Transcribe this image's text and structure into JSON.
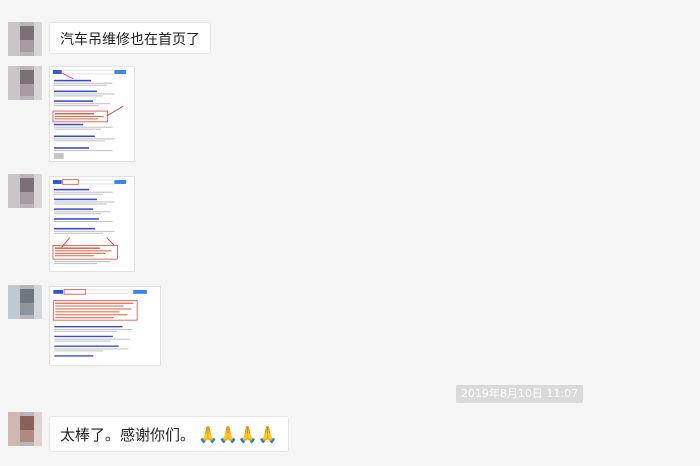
{
  "messages": [
    {
      "type": "text",
      "text": "汽车吊维修也在首页了"
    },
    {
      "type": "image",
      "content": "search-results-screenshot"
    },
    {
      "type": "image",
      "content": "search-results-screenshot"
    },
    {
      "type": "image",
      "content": "search-results-screenshot"
    },
    {
      "type": "text",
      "text": "太棒了。感谢你们。",
      "emoji": "🙏🙏🙏🙏"
    }
  ],
  "timestamp": "2019年8月10日 11:07",
  "colors": {
    "background": "#f5f5f5",
    "bubble": "#ffffff",
    "timestamp_bg": "#dadada",
    "highlight_box": "#e0413a",
    "link": "#3b4bd1"
  }
}
